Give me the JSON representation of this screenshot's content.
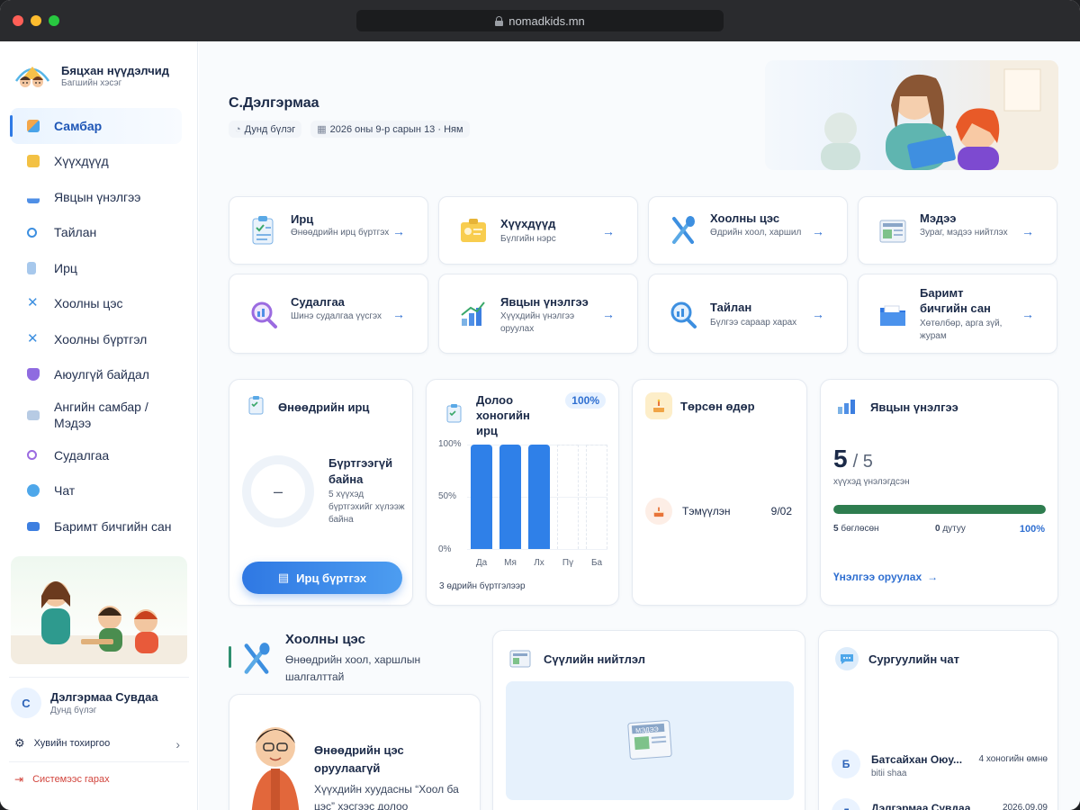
{
  "browser": {
    "url": "nomadkids.mn"
  },
  "sidebar": {
    "brand_title": "Бяцхан нүүдэлчид",
    "brand_subtitle": "Багшийн хэсэг",
    "items": [
      {
        "label": "Самбар",
        "icon": "dashboard-icon"
      },
      {
        "label": "Хүүхдүүд",
        "icon": "children-icon"
      },
      {
        "label": "Явцын үнэлгээ",
        "icon": "progress-icon"
      },
      {
        "label": "Тайлан",
        "icon": "report-icon"
      },
      {
        "label": "Ирц",
        "icon": "attendance-icon"
      },
      {
        "label": "Хоолны цэс",
        "icon": "menu-icon"
      },
      {
        "label": "Хоолны бүртгэл",
        "icon": "meal-log-icon"
      },
      {
        "label": "Аюулгүй байдал",
        "icon": "shield-icon"
      },
      {
        "label": "Ангийн самбар / Мэдээ",
        "icon": "news-icon"
      },
      {
        "label": "Судалгаа",
        "icon": "survey-icon"
      },
      {
        "label": "Чат",
        "icon": "chat-icon"
      },
      {
        "label": "Баримт бичгийн сан",
        "icon": "folder-icon"
      }
    ],
    "user_initial": "С",
    "user_name": "Дэлгэрмаа Сувдаа",
    "user_group": "Дунд бүлэг",
    "settings_label": "Хувийн тохиргоо",
    "logout_label": "Системээс гарах"
  },
  "header": {
    "teacher_name": "С.Дэлгэрмаа",
    "group_chip": "Дунд бүлэг",
    "date_chip": "2026 оны 9-р сарын 13 · Ням"
  },
  "quick_links": [
    {
      "title": "Ирц",
      "desc": "Өнөөдрийн ирц бүртгэх",
      "icon": "clipboard-icon",
      "color": "#5aa9e6"
    },
    {
      "title": "Хүүхдүүд",
      "desc": "Бүлгийн нэрс",
      "icon": "id-card-icon",
      "color": "#f3c144"
    },
    {
      "title": "Хоолны цэс",
      "desc": "Өдрийн хоол, харшил",
      "icon": "fork-spoon-icon",
      "color": "#3d8fe0"
    },
    {
      "title": "Мэдээ",
      "desc": "Зураг, мэдээ нийтлэх",
      "icon": "newspaper-icon",
      "color": "#8aa6c8"
    },
    {
      "title": "Судалгаа",
      "desc": "Шинэ судалгаа үүсгэх",
      "icon": "magnifier-icon",
      "color": "#9b6be0"
    },
    {
      "title": "Явцын үнэлгээ",
      "desc": "Хүүхдийн үнэлгээ оруулах",
      "icon": "chart-icon",
      "color": "#4f8fe6"
    },
    {
      "title": "Тайлан",
      "desc": "Бүлгээ сараар харах",
      "icon": "search-report-icon",
      "color": "#3d8fe0"
    },
    {
      "title": "Баримт бичгийн сан",
      "desc": "Хөтөлбөр, арга зүй, журам",
      "icon": "folder-icon",
      "color": "#2f78e3"
    }
  ],
  "attendance_today": {
    "title": "Өнөөдрийн ирц",
    "ring_text": "–",
    "status_title": "Бүртгээгүй байна",
    "status_desc": "5 хүүхэд бүртгэхийг хүлээж байна",
    "button_label": "Ирц бүртгэх"
  },
  "weekly_attendance": {
    "title": "Долоо хоногийн ирц",
    "badge": "100%",
    "footer": "3 өдрийн бүртгэлээр"
  },
  "chart_data": {
    "type": "bar",
    "categories": [
      "Да",
      "Мя",
      "Лх",
      "Пү",
      "Ба"
    ],
    "values": [
      100,
      100,
      100,
      null,
      null
    ],
    "ylim": [
      0,
      100
    ],
    "yticks": [
      "100%",
      "50%",
      "0%"
    ],
    "bar_color": "#2f80e8"
  },
  "birthday": {
    "title": "Төрсөн өдөр",
    "name": "Тэмүүлэн",
    "date": "9/02"
  },
  "assessment": {
    "title": "Явцын үнэлгээ",
    "big": "5",
    "total": "/ 5",
    "caption": "хүүхэд үнэлэгдсэн",
    "progress_fraction": 1.0,
    "done_count": "5",
    "done_label": "бөглөсөн",
    "missing_count": "0",
    "missing_label": "дутуу",
    "percent": "100%",
    "link": "Үнэлгээ оруулах",
    "accent": "#2e7d4f"
  },
  "food": {
    "title": "Хоолны цэс",
    "subtitle": "Өнөөдрийн хоол, харшлын шалгалттай",
    "status_title": "Өнөөдрийн цэс оруулаагүй",
    "status_desc": "Хүүхдийн хуудасны “Хоол ба цэс” хэсгээс долоо"
  },
  "news": {
    "title": "Сүүлийн нийтлэл",
    "thumb_label": "МЭДЭЭ"
  },
  "chat": {
    "title": "Сургуулийн чат",
    "messages": [
      {
        "initial": "Б",
        "name": "Батсайхан Оюу...",
        "text": "bitii shaa",
        "time": "4 хоногийн өмнө"
      },
      {
        "initial": "Д",
        "name": "Дэлгэрмаа Сувдаа",
        "text": "",
        "time": "2026.09.09"
      }
    ]
  }
}
